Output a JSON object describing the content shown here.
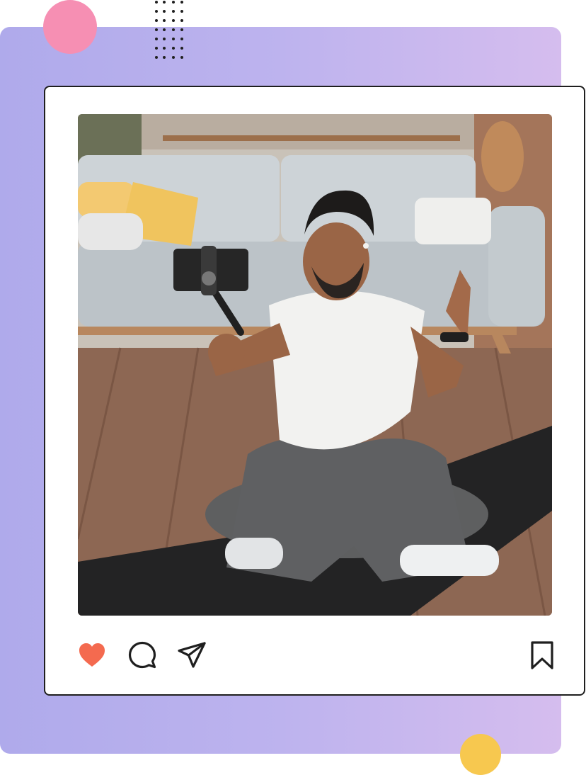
{
  "post": {
    "liked": true
  },
  "actions": {
    "icons": [
      "heart-icon",
      "comment-icon",
      "share-icon",
      "bookmark-icon"
    ]
  },
  "colors": {
    "heart": "#f46a4f",
    "icon_stroke": "#1f1f1f",
    "gradient_start": "#afaaeb",
    "gradient_end": "#d5bdee",
    "accent_pink": "#f68fb3",
    "accent_yellow": "#f7c84f"
  }
}
